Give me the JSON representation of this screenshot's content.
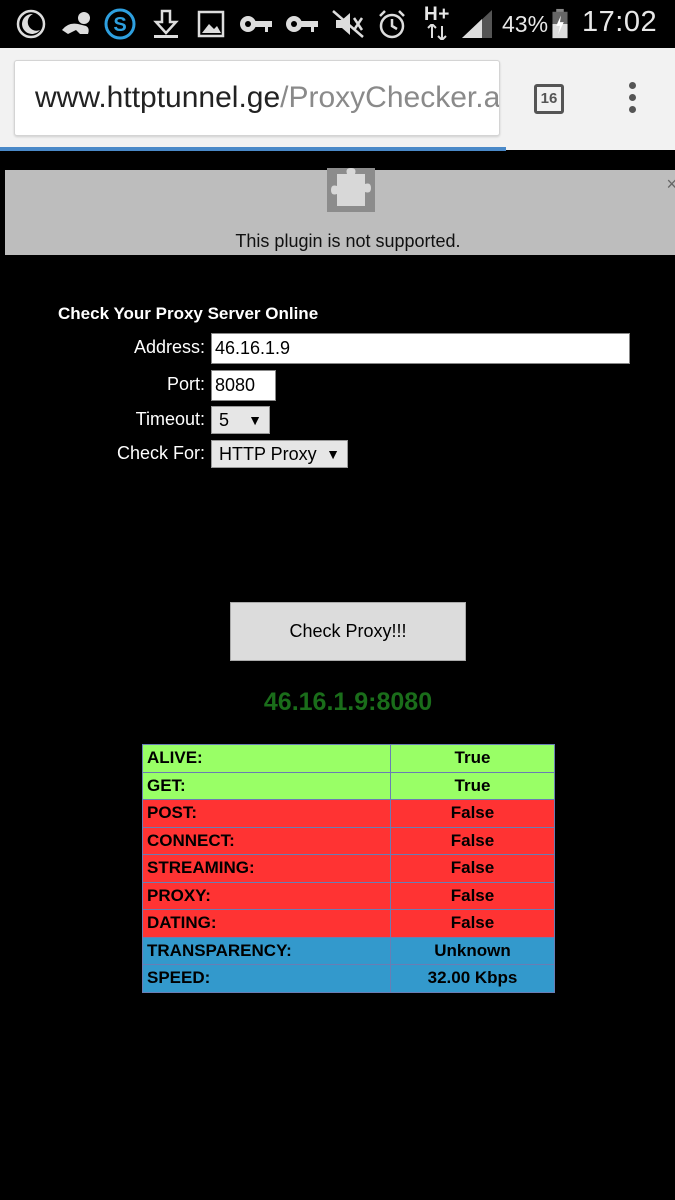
{
  "status_bar": {
    "battery_percent": "43%",
    "time": "17:02",
    "network_type": "H+",
    "icons": [
      "moon-icon",
      "baby-icon",
      "skype-icon",
      "download-icon",
      "image-icon",
      "key-icon",
      "key-icon",
      "mute-icon",
      "alarm-icon",
      "signal-icon",
      "battery-icon"
    ]
  },
  "browser": {
    "url_host": "www.httptunnel.ge",
    "url_path": "/ProxyChecker.a",
    "tab_count": "16",
    "progress_percent": 75
  },
  "plugin": {
    "message": "This plugin is not supported.",
    "close_symbol": "×"
  },
  "form": {
    "title": "Check Your Proxy Server Online",
    "address_label": "Address:",
    "address_value": "46.16.1.9",
    "port_label": "Port:",
    "port_value": "8080",
    "timeout_label": "Timeout:",
    "timeout_value": "5",
    "checkfor_label": "Check For:",
    "checkfor_value": "HTTP Proxy",
    "check_button": "Check Proxy!!!"
  },
  "result": {
    "title": "46.16.1.9:8080",
    "rows": [
      {
        "key": "ALIVE:",
        "value": "True",
        "color": "#99ff66"
      },
      {
        "key": "GET:",
        "value": "True",
        "color": "#99ff66"
      },
      {
        "key": "POST:",
        "value": "False",
        "color": "#ff3333"
      },
      {
        "key": "CONNECT:",
        "value": "False",
        "color": "#ff3333"
      },
      {
        "key": "STREAMING:",
        "value": "False",
        "color": "#ff3333"
      },
      {
        "key": "PROXY:",
        "value": "False",
        "color": "#ff3333"
      },
      {
        "key": "DATING:",
        "value": "False",
        "color": "#ff3333"
      },
      {
        "key": "TRANSPARENCY:",
        "value": "Unknown",
        "color": "#3399cc"
      },
      {
        "key": "SPEED:",
        "value": "32.00 Kbps",
        "color": "#3399cc"
      }
    ]
  }
}
